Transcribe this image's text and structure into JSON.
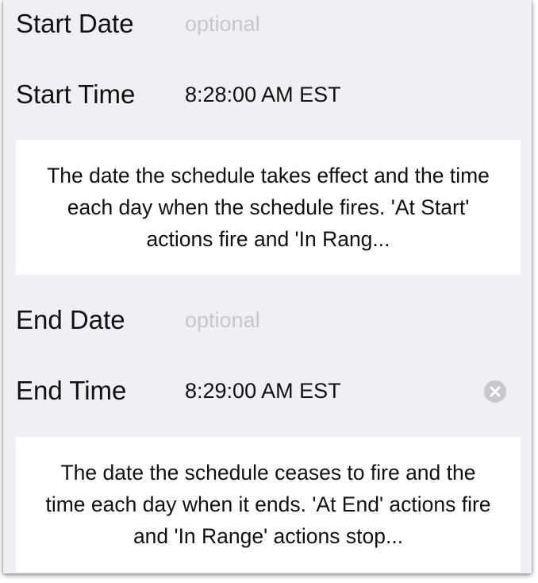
{
  "start": {
    "date_label": "Start Date",
    "date_placeholder": "optional",
    "time_label": "Start Time",
    "time_value": "8:28:00 AM EST",
    "description": "The date the schedule takes effect and the time each day when the schedule fires. 'At Start' actions fire and 'In Rang..."
  },
  "end": {
    "date_label": "End Date",
    "date_placeholder": "optional",
    "time_label": "End Time",
    "time_value": "8:29:00 AM EST",
    "description": "The date the schedule ceases to fire and the time each day when it ends. 'At End' actions fire and 'In Range' actions stop..."
  },
  "icons": {
    "clear": "clear-circle-icon"
  },
  "colors": {
    "background": "#efeff4",
    "placeholder": "#c7c7cd",
    "clear_icon": "#c7c7cc"
  }
}
